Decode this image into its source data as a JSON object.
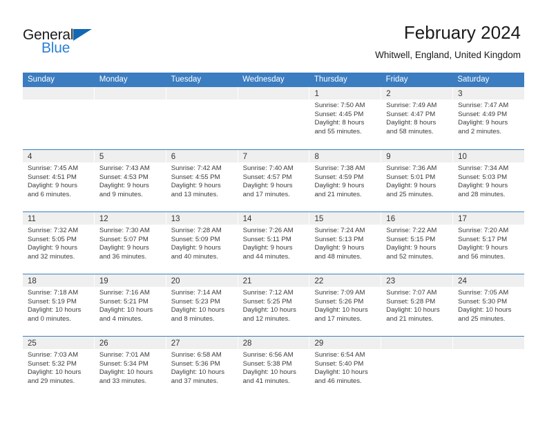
{
  "brand": {
    "name_dark": "General",
    "name_blue": "Blue",
    "accent_color": "#1268b3",
    "blue_text_color": "#2b7fd4"
  },
  "header": {
    "title": "February 2024",
    "subtitle": "Whitwell, England, United Kingdom"
  },
  "calendar": {
    "header_bg": "#3b7dc0",
    "day_band_bg": "#efefef",
    "weekday_names": [
      "Sunday",
      "Monday",
      "Tuesday",
      "Wednesday",
      "Thursday",
      "Friday",
      "Saturday"
    ],
    "weeks": [
      [
        {
          "day": "",
          "lines": []
        },
        {
          "day": "",
          "lines": []
        },
        {
          "day": "",
          "lines": []
        },
        {
          "day": "",
          "lines": []
        },
        {
          "day": "1",
          "lines": [
            "Sunrise: 7:50 AM",
            "Sunset: 4:45 PM",
            "Daylight: 8 hours",
            "and 55 minutes."
          ]
        },
        {
          "day": "2",
          "lines": [
            "Sunrise: 7:49 AM",
            "Sunset: 4:47 PM",
            "Daylight: 8 hours",
            "and 58 minutes."
          ]
        },
        {
          "day": "3",
          "lines": [
            "Sunrise: 7:47 AM",
            "Sunset: 4:49 PM",
            "Daylight: 9 hours",
            "and 2 minutes."
          ]
        }
      ],
      [
        {
          "day": "4",
          "lines": [
            "Sunrise: 7:45 AM",
            "Sunset: 4:51 PM",
            "Daylight: 9 hours",
            "and 6 minutes."
          ]
        },
        {
          "day": "5",
          "lines": [
            "Sunrise: 7:43 AM",
            "Sunset: 4:53 PM",
            "Daylight: 9 hours",
            "and 9 minutes."
          ]
        },
        {
          "day": "6",
          "lines": [
            "Sunrise: 7:42 AM",
            "Sunset: 4:55 PM",
            "Daylight: 9 hours",
            "and 13 minutes."
          ]
        },
        {
          "day": "7",
          "lines": [
            "Sunrise: 7:40 AM",
            "Sunset: 4:57 PM",
            "Daylight: 9 hours",
            "and 17 minutes."
          ]
        },
        {
          "day": "8",
          "lines": [
            "Sunrise: 7:38 AM",
            "Sunset: 4:59 PM",
            "Daylight: 9 hours",
            "and 21 minutes."
          ]
        },
        {
          "day": "9",
          "lines": [
            "Sunrise: 7:36 AM",
            "Sunset: 5:01 PM",
            "Daylight: 9 hours",
            "and 25 minutes."
          ]
        },
        {
          "day": "10",
          "lines": [
            "Sunrise: 7:34 AM",
            "Sunset: 5:03 PM",
            "Daylight: 9 hours",
            "and 28 minutes."
          ]
        }
      ],
      [
        {
          "day": "11",
          "lines": [
            "Sunrise: 7:32 AM",
            "Sunset: 5:05 PM",
            "Daylight: 9 hours",
            "and 32 minutes."
          ]
        },
        {
          "day": "12",
          "lines": [
            "Sunrise: 7:30 AM",
            "Sunset: 5:07 PM",
            "Daylight: 9 hours",
            "and 36 minutes."
          ]
        },
        {
          "day": "13",
          "lines": [
            "Sunrise: 7:28 AM",
            "Sunset: 5:09 PM",
            "Daylight: 9 hours",
            "and 40 minutes."
          ]
        },
        {
          "day": "14",
          "lines": [
            "Sunrise: 7:26 AM",
            "Sunset: 5:11 PM",
            "Daylight: 9 hours",
            "and 44 minutes."
          ]
        },
        {
          "day": "15",
          "lines": [
            "Sunrise: 7:24 AM",
            "Sunset: 5:13 PM",
            "Daylight: 9 hours",
            "and 48 minutes."
          ]
        },
        {
          "day": "16",
          "lines": [
            "Sunrise: 7:22 AM",
            "Sunset: 5:15 PM",
            "Daylight: 9 hours",
            "and 52 minutes."
          ]
        },
        {
          "day": "17",
          "lines": [
            "Sunrise: 7:20 AM",
            "Sunset: 5:17 PM",
            "Daylight: 9 hours",
            "and 56 minutes."
          ]
        }
      ],
      [
        {
          "day": "18",
          "lines": [
            "Sunrise: 7:18 AM",
            "Sunset: 5:19 PM",
            "Daylight: 10 hours",
            "and 0 minutes."
          ]
        },
        {
          "day": "19",
          "lines": [
            "Sunrise: 7:16 AM",
            "Sunset: 5:21 PM",
            "Daylight: 10 hours",
            "and 4 minutes."
          ]
        },
        {
          "day": "20",
          "lines": [
            "Sunrise: 7:14 AM",
            "Sunset: 5:23 PM",
            "Daylight: 10 hours",
            "and 8 minutes."
          ]
        },
        {
          "day": "21",
          "lines": [
            "Sunrise: 7:12 AM",
            "Sunset: 5:25 PM",
            "Daylight: 10 hours",
            "and 12 minutes."
          ]
        },
        {
          "day": "22",
          "lines": [
            "Sunrise: 7:09 AM",
            "Sunset: 5:26 PM",
            "Daylight: 10 hours",
            "and 17 minutes."
          ]
        },
        {
          "day": "23",
          "lines": [
            "Sunrise: 7:07 AM",
            "Sunset: 5:28 PM",
            "Daylight: 10 hours",
            "and 21 minutes."
          ]
        },
        {
          "day": "24",
          "lines": [
            "Sunrise: 7:05 AM",
            "Sunset: 5:30 PM",
            "Daylight: 10 hours",
            "and 25 minutes."
          ]
        }
      ],
      [
        {
          "day": "25",
          "lines": [
            "Sunrise: 7:03 AM",
            "Sunset: 5:32 PM",
            "Daylight: 10 hours",
            "and 29 minutes."
          ]
        },
        {
          "day": "26",
          "lines": [
            "Sunrise: 7:01 AM",
            "Sunset: 5:34 PM",
            "Daylight: 10 hours",
            "and 33 minutes."
          ]
        },
        {
          "day": "27",
          "lines": [
            "Sunrise: 6:58 AM",
            "Sunset: 5:36 PM",
            "Daylight: 10 hours",
            "and 37 minutes."
          ]
        },
        {
          "day": "28",
          "lines": [
            "Sunrise: 6:56 AM",
            "Sunset: 5:38 PM",
            "Daylight: 10 hours",
            "and 41 minutes."
          ]
        },
        {
          "day": "29",
          "lines": [
            "Sunrise: 6:54 AM",
            "Sunset: 5:40 PM",
            "Daylight: 10 hours",
            "and 46 minutes."
          ]
        },
        {
          "day": "",
          "lines": []
        },
        {
          "day": "",
          "lines": []
        }
      ]
    ]
  }
}
